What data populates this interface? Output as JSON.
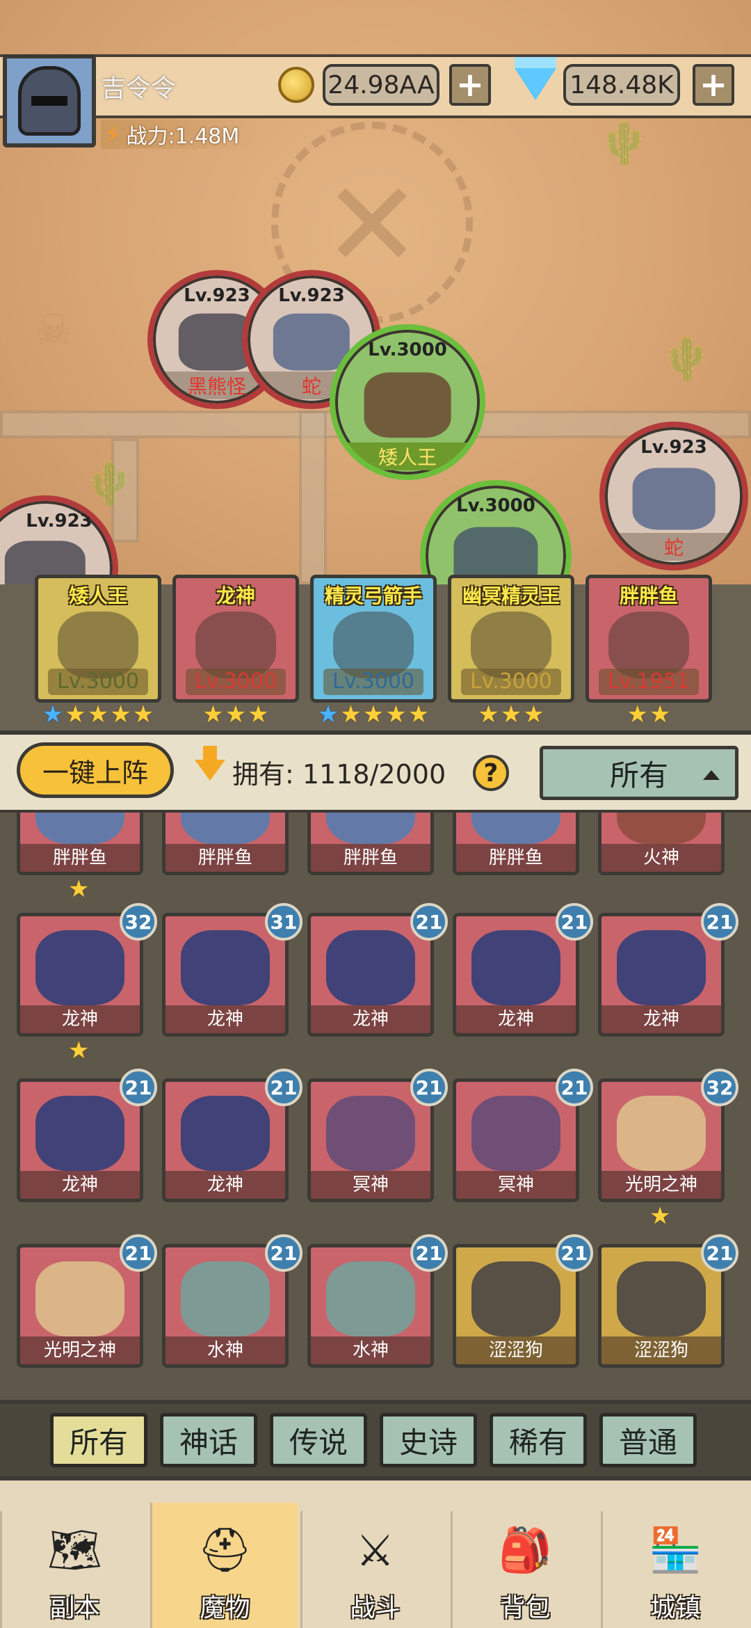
{
  "player": {
    "name": "吉令令",
    "power_label": "战力:1.48M"
  },
  "currency": {
    "gold": "24.98AA",
    "gems": "148.48K",
    "plus": "+"
  },
  "map_nodes": [
    {
      "level": "Lv.923",
      "name": "黑熊怪",
      "status": "enemy"
    },
    {
      "level": "Lv.923",
      "name": "蛇",
      "status": "enemy"
    },
    {
      "level": "Lv.3000",
      "name": "矮人王",
      "status": "cleared"
    },
    {
      "level": "Lv.923",
      "name": "蛇",
      "status": "enemy"
    },
    {
      "level": "Lv.923",
      "name": "",
      "status": "enemy"
    },
    {
      "level": "Lv.3000",
      "name": "",
      "status": "cleared"
    }
  ],
  "formation": [
    {
      "name": "矮人王",
      "level": "Lv.3000",
      "stars": 5,
      "blue_stars": 1,
      "level_color": "#5a6a30",
      "bg": "#d4bd5a"
    },
    {
      "name": "龙神",
      "level": "Lv.3000",
      "stars": 3,
      "blue_stars": 0,
      "level_color": "#d63a32",
      "bg": "#c9646b"
    },
    {
      "name": "精灵弓箭手",
      "level": "Lv.3000",
      "stars": 5,
      "blue_stars": 1,
      "level_color": "#2f6a95",
      "bg": "#6bbede"
    },
    {
      "name": "幽冥精灵王",
      "level": "Lv.3000",
      "stars": 3,
      "blue_stars": 0,
      "level_color": "#c9a23a",
      "bg": "#d4bd5a"
    },
    {
      "name": "胖胖鱼",
      "level": "Lv.1951",
      "stars": 2,
      "blue_stars": 0,
      "level_color": "#d63a32",
      "bg": "#c9646b"
    }
  ],
  "controls": {
    "deploy_label": "一键上阵",
    "own_label": "拥有:",
    "own_count": "1118/2000",
    "help": "?",
    "filter_value": "所有"
  },
  "monsters": [
    {
      "name": "胖胖鱼",
      "badge": "",
      "color": "red",
      "art": "#4a7fb8",
      "star": true
    },
    {
      "name": "胖胖鱼",
      "badge": "",
      "color": "red",
      "art": "#4a7fb8",
      "star": false
    },
    {
      "name": "胖胖鱼",
      "badge": "",
      "color": "red",
      "art": "#4a7fb8",
      "star": false
    },
    {
      "name": "胖胖鱼",
      "badge": "",
      "color": "red",
      "art": "#4a7fb8",
      "star": false
    },
    {
      "name": "火神",
      "badge": "",
      "color": "red",
      "art": "#8a4a3a",
      "star": false
    },
    {
      "name": "龙神",
      "badge": "32",
      "color": "red",
      "art": "#1f3a7a",
      "star": true
    },
    {
      "name": "龙神",
      "badge": "31",
      "color": "red",
      "art": "#1f3a7a",
      "star": false
    },
    {
      "name": "龙神",
      "badge": "21",
      "color": "red",
      "art": "#1f3a7a",
      "star": false
    },
    {
      "name": "龙神",
      "badge": "21",
      "color": "red",
      "art": "#1f3a7a",
      "star": false
    },
    {
      "name": "龙神",
      "badge": "21",
      "color": "red",
      "art": "#1f3a7a",
      "star": false
    },
    {
      "name": "龙神",
      "badge": "21",
      "color": "red",
      "art": "#1f3a7a",
      "star": false
    },
    {
      "name": "龙神",
      "badge": "21",
      "color": "red",
      "art": "#1f3a7a",
      "star": false
    },
    {
      "name": "冥神",
      "badge": "21",
      "color": "red",
      "art": "#5a4a7a",
      "star": false
    },
    {
      "name": "冥神",
      "badge": "21",
      "color": "red",
      "art": "#5a4a7a",
      "star": false
    },
    {
      "name": "光明之神",
      "badge": "32",
      "color": "red",
      "art": "#e0c890",
      "star": true
    },
    {
      "name": "光明之神",
      "badge": "21",
      "color": "red",
      "art": "#e0c890",
      "star": false
    },
    {
      "name": "水神",
      "badge": "21",
      "color": "red",
      "art": "#6aa8a0",
      "star": false
    },
    {
      "name": "水神",
      "badge": "21",
      "color": "red",
      "art": "#6aa8a0",
      "star": false
    },
    {
      "name": "涩涩狗",
      "badge": "21",
      "color": "gold",
      "art": "#3a3a44",
      "star": false
    },
    {
      "name": "涩涩狗",
      "badge": "21",
      "color": "gold",
      "art": "#3a3a44",
      "star": false
    }
  ],
  "rarity_tabs": [
    "所有",
    "神话",
    "传说",
    "史诗",
    "稀有",
    "普通"
  ],
  "nav": [
    {
      "label": "副本",
      "icon": "map-icon",
      "glyph": "🗺"
    },
    {
      "label": "魔物",
      "icon": "helmet-icon",
      "glyph": "⛑"
    },
    {
      "label": "战斗",
      "icon": "swords-icon",
      "glyph": "⚔"
    },
    {
      "label": "背包",
      "icon": "backpack-icon",
      "glyph": "🎒"
    },
    {
      "label": "城镇",
      "icon": "shop-icon",
      "glyph": "🏪"
    }
  ],
  "colors": {
    "accent": "#f7c23a",
    "enemy_ring": "#b33b3b",
    "cleared_ring": "#6cbf3c",
    "badge": "#3e7fae"
  }
}
